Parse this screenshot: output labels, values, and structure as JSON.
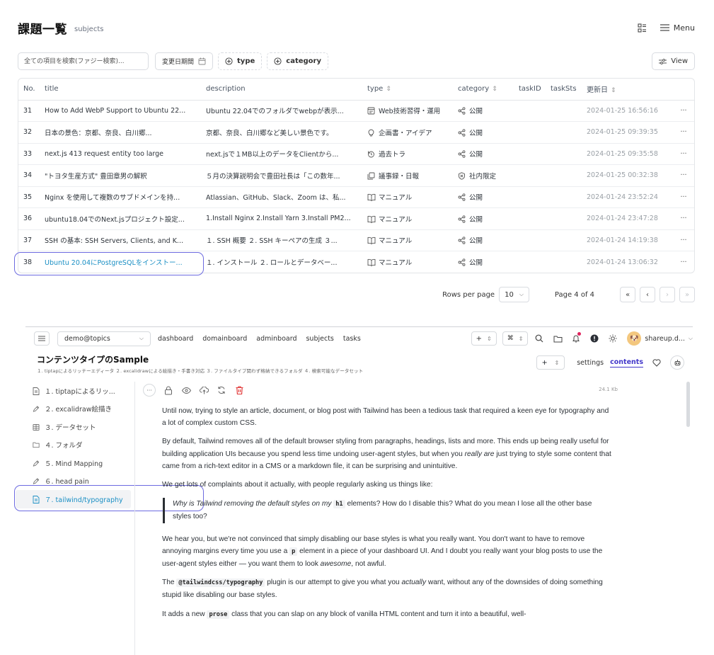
{
  "header": {
    "title": "課題一覧",
    "subtitle": "subjects",
    "menu_label": "Menu"
  },
  "filters": {
    "search_placeholder": "全ての項目を検索(ファジー検索)...",
    "date_chip": "変更日期間",
    "type_chip": "type",
    "category_chip": "category",
    "view_label": "View"
  },
  "table": {
    "columns": [
      "No.",
      "title",
      "description",
      "type",
      "category",
      "taskID",
      "taskSts",
      "更新日",
      ""
    ],
    "rows": [
      {
        "no": "31",
        "title": "How to Add WebP Support to Ubuntu 22...",
        "description": "Ubuntu 22.04でのフォルダでwebpが表示...",
        "type": "Web技術習得・運用",
        "type_icon": "web-icon",
        "category": "公開",
        "category_icon": "share-icon",
        "date": "2024-01-25 16:56:16"
      },
      {
        "no": "32",
        "title": "日本の景色：京都、奈良、白川郷...",
        "description": "京都、奈良、白川郷など美しい景色です。",
        "type": "企画書・アイデア",
        "type_icon": "lightbulb-icon",
        "category": "公開",
        "category_icon": "share-icon",
        "date": "2024-01-25 09:39:35"
      },
      {
        "no": "33",
        "title": "next.js 413 request entity too large",
        "description": "next.jsで１MB以上のデータをClientから...",
        "type": "過去トラ",
        "type_icon": "history-icon",
        "category": "公開",
        "category_icon": "share-icon",
        "date": "2024-01-25 09:35:58"
      },
      {
        "no": "34",
        "title": "\"トヨタ生産方式\" 豊田章男の解釈",
        "description": "５月の決算説明会で豊田社長は「この数年...",
        "type": "議事録・日報",
        "type_icon": "minutes-icon",
        "category": "社内限定",
        "category_icon": "shield-icon",
        "date": "2024-01-25 00:32:38"
      },
      {
        "no": "35",
        "title": "Nginx を使用して複数のサブドメインを持...",
        "description": "Atlassian、GitHub、Slack、Zoom は、私...",
        "type": "マニュアル",
        "type_icon": "book-icon",
        "category": "公開",
        "category_icon": "share-icon",
        "date": "2024-01-24 23:52:24"
      },
      {
        "no": "36",
        "title": "ubuntu18.04でのNext.jsプロジェクト設定...",
        "description": "1.Install Nginx 2.Install Yarn 3.Install PM2...",
        "type": "マニュアル",
        "type_icon": "book-icon",
        "category": "公開",
        "category_icon": "share-icon",
        "date": "2024-01-24 23:47:28"
      },
      {
        "no": "37",
        "title": "SSH の基本: SSH Servers, Clients, and K...",
        "description": "１. SSH 概要 ２. SSH キーペアの生成 ３...",
        "type": "マニュアル",
        "type_icon": "book-icon",
        "category": "公開",
        "category_icon": "share-icon",
        "date": "2024-01-24 14:19:38"
      },
      {
        "no": "38",
        "title": "Ubuntu 20.04にPostgreSQLをインストー...",
        "description": "１. インストール ２. ロールとデータベー...",
        "type": "マニュアル",
        "type_icon": "book-icon",
        "category": "公開",
        "category_icon": "share-icon",
        "date": "2024-01-24 13:06:32"
      }
    ],
    "row_menu": "···"
  },
  "pagination": {
    "rows_per_page_label": "Rows per page",
    "rows_per_page": "10",
    "page_label": "Page 4 of 4"
  },
  "app": {
    "workspace": "demo@topics",
    "nav_links": [
      "dashboard",
      "domainboard",
      "adminboard",
      "subjects",
      "tasks"
    ],
    "user": "shareup.d...",
    "content_title": "コンテンツタイプのSample",
    "content_subtitle": "１. tiptapによるリッチーエディータ ２. excalidrawによる絵描き・手書き対応 ３. ファイルタイプ関わず格納できるフォルダ ４. 検索可能なデータセット",
    "tabs": {
      "settings": "settings",
      "contents": "contents"
    },
    "file_size": "24.1 Kb",
    "sidebar": [
      {
        "label": "１. tiptapによるリッ...",
        "icon": "document-icon"
      },
      {
        "label": "２. excalidraw絵描き",
        "icon": "pen-icon"
      },
      {
        "label": "３. データセット",
        "icon": "table-icon"
      },
      {
        "label": "４. フォルダ",
        "icon": "folder-icon"
      },
      {
        "label": "５. Mind Mapping",
        "icon": "pen-icon"
      },
      {
        "label": "６. head pain",
        "icon": "pen-icon"
      },
      {
        "label": "７. tailwind/typography",
        "icon": "document-icon",
        "active": true
      }
    ],
    "prose": {
      "p1": "Until now, trying to style an article, document, or blog post with Tailwind has been a tedious task that required a keen eye for typography and a lot of complex custom CSS.",
      "p2a": "By default, Tailwind removes all of the default browser styling from paragraphs, headings, lists and more. This ends up being really useful for building application UIs because you spend less time undoing user-agent styles, but when you ",
      "p2em": "really are",
      "p2b": " just trying to style some content that came from a rich-text editor in a CMS or a markdown file, it can be surprising and unintuitive.",
      "p3": "We get lots of complaints about it actually, with people regularly asking us things like:",
      "q_em": "Why is Tailwind removing the default styles on my ",
      "q_code": "h1",
      "q_rest": " elements? How do I disable this? What do you mean I lose all the other base styles too?",
      "p4a": "We hear you, but we're not convinced that simply disabling our base styles is what you really want. You don't want to have to remove annoying margins every time you use a ",
      "p4code": "p",
      "p4b": " element in a piece of your dashboard UI. And I doubt you really want your blog posts to use the user-agent styles either — you want them to look ",
      "p4em": "awesome",
      "p4c": ", not awful.",
      "p5a": "The ",
      "p5code": "@tailwindcss/typography",
      "p5b": " plugin is our attempt to give you what you ",
      "p5em": "actually",
      "p5c": " want, without any of the downsides of doing something stupid like disabling our base styles.",
      "p6a": "It adds a new ",
      "p6code": "prose",
      "p6b": " class that you can slap on any block of vanilla HTML content and turn it into a beautiful, well-"
    }
  }
}
